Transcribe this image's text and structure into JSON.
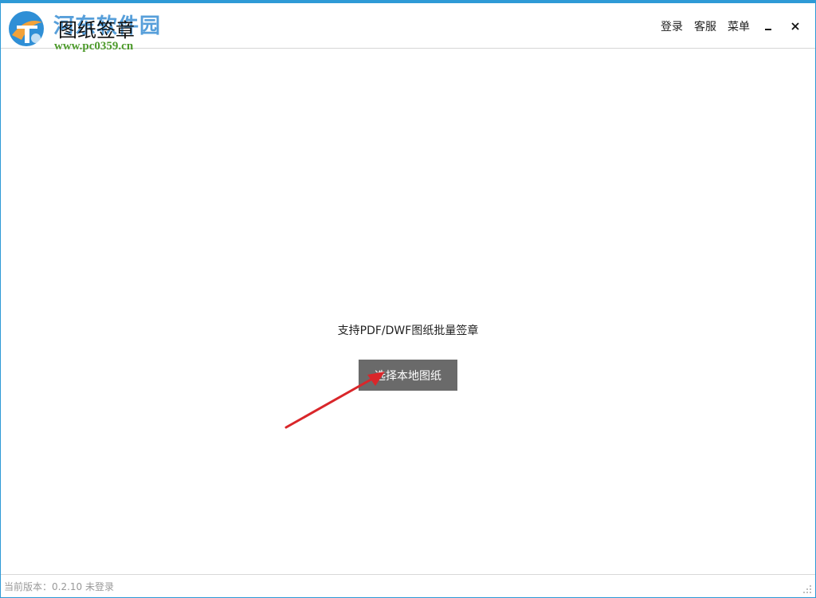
{
  "header": {
    "watermark_cn": "河东软件园",
    "watermark_url": "www.pc0359.cn",
    "app_title": "图纸签章",
    "login_label": "登录",
    "service_label": "客服",
    "menu_label": "菜单"
  },
  "main": {
    "support_text": "支持PDF/DWF图纸批量签章",
    "choose_button_label": "选择本地图纸"
  },
  "status": {
    "version_text": "当前版本：0.2.10 未登录"
  },
  "colors": {
    "accent": "#2e9ad6",
    "button_bg": "#6a6a6a",
    "arrow": "#d9262a",
    "watermark_blue": "#3a8fd4",
    "watermark_green": "#4c9a2a"
  },
  "icons": {
    "logo": "site-logo-icon",
    "minimize": "minimize-icon",
    "close": "close-icon",
    "resize": "resize-grip-icon"
  }
}
